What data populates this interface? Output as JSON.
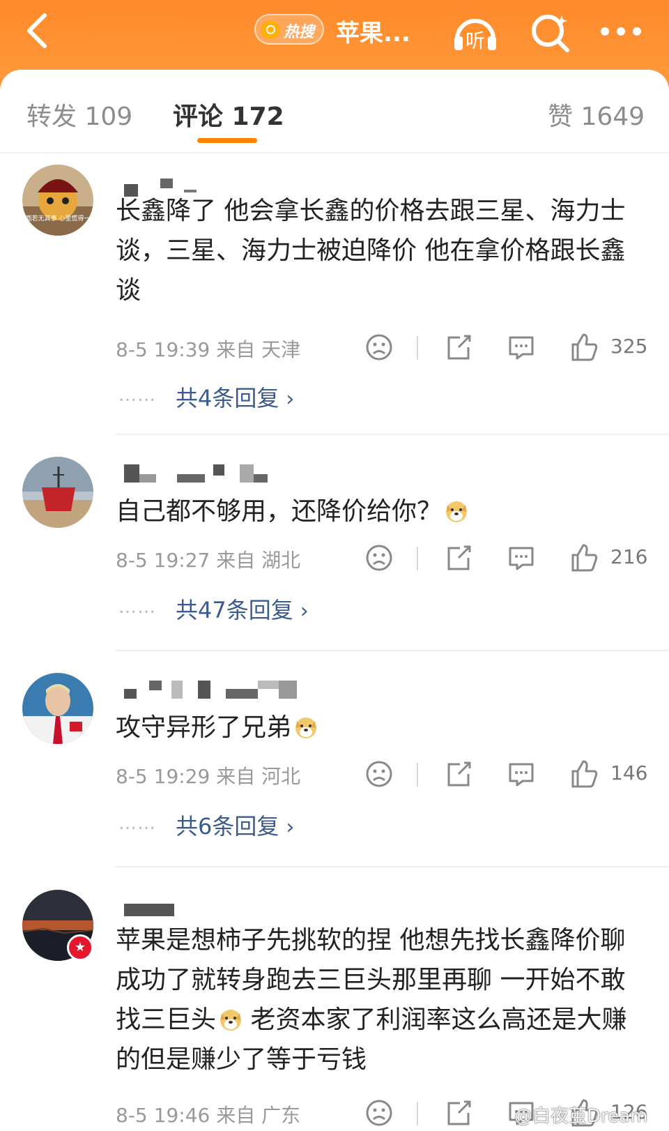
{
  "header": {
    "hot_label": "热搜",
    "title": "苹果...",
    "back_icon": "chevron-left-icon",
    "listen_icon": "headphones-listen-icon",
    "listen_label": "听",
    "search_icon": "search-icon",
    "more_icon": "more-dots-icon",
    "colors": {
      "bar": "#ff8a2a",
      "accent": "#ff8200"
    }
  },
  "tabs": [
    {
      "label": "转发 109"
    },
    {
      "label": "评论 172"
    },
    {
      "label": "赞 1649"
    }
  ],
  "comments": [
    {
      "text": "长鑫降了 他会拿长鑫的价格去跟三星、海力士谈，三星、海力士被迫降价 他在拿价格跟长鑫谈",
      "meta": "8-5 19:39  来自 天津",
      "likes": "325",
      "replies": "共4条回复",
      "avatar_text": "表面若无其事 心里慌得一批"
    },
    {
      "text": "自己都不够用，还降价给你？",
      "meta": "8-5 19:27  来自 湖北",
      "likes": "216",
      "replies": "共47条回复"
    },
    {
      "text": "攻守异形了兄弟",
      "meta": "8-5 19:29  来自 河北",
      "likes": "146",
      "replies": "共6条回复"
    },
    {
      "text_a": "苹果是想柿子先挑软的捏 他想先找长鑫降价聊成功了就转身跑去三巨头那里再聊 一开始不敢找三巨头",
      "text_b": "老资本家了利润率这么高还是大赚的但是赚少了等于亏钱",
      "meta": "8-5 19:46  来自 广东",
      "likes": "126"
    }
  ],
  "reply_dots": "……",
  "watermark": "@白夜茧Dream"
}
